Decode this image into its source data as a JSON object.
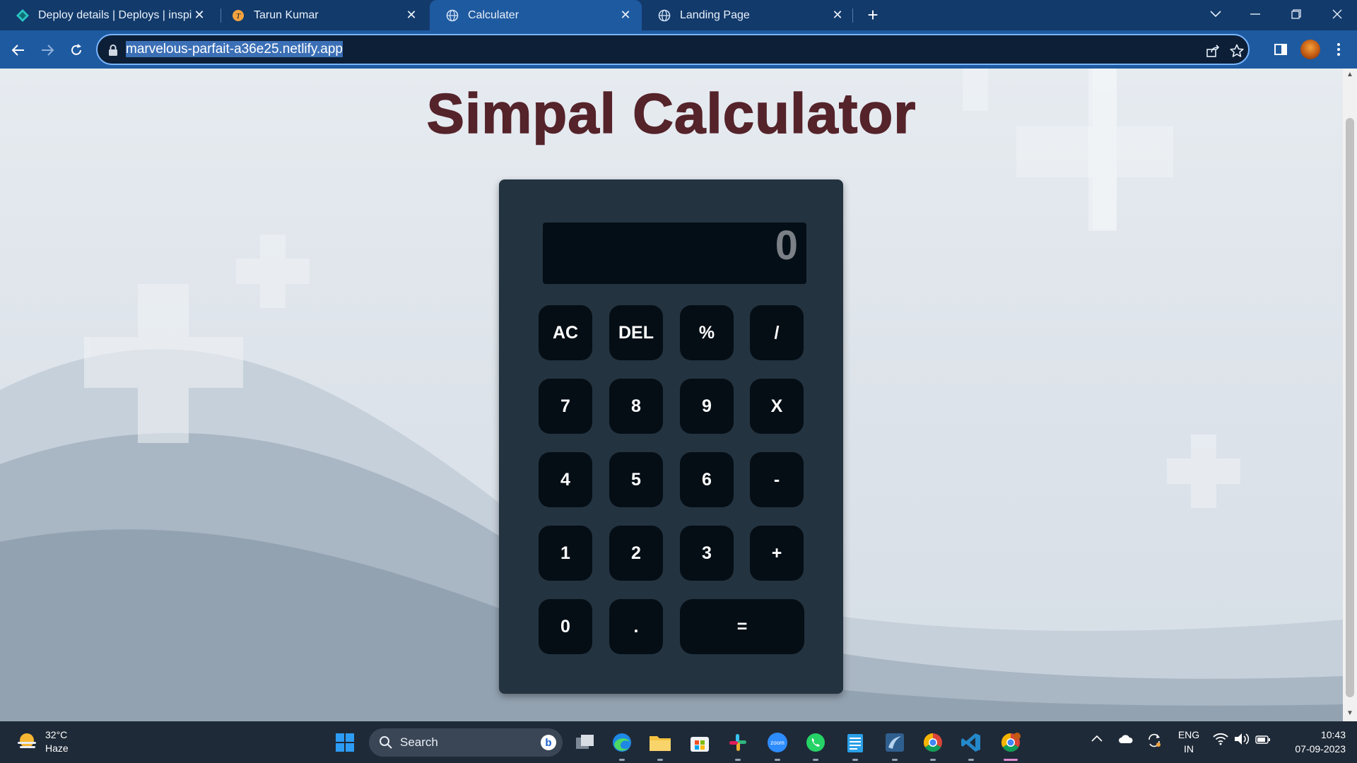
{
  "browser": {
    "tabs": [
      {
        "title": "Deploy details | Deploys | inspirin",
        "active": false
      },
      {
        "title": "Tarun Kumar",
        "active": false
      },
      {
        "title": "Calculater",
        "active": true
      },
      {
        "title": "Landing Page",
        "active": false
      }
    ],
    "url": "marvelous-parfait-a36e25.netlify.app"
  },
  "page": {
    "heading": "Simpal Calculator",
    "display": "0",
    "keys": [
      "AC",
      "DEL",
      "%",
      "/",
      "7",
      "8",
      "9",
      "X",
      "4",
      "5",
      "6",
      "-",
      "1",
      "2",
      "3",
      "+",
      "0",
      ".",
      "="
    ]
  },
  "taskbar": {
    "weather": {
      "temp": "32°C",
      "condition": "Haze"
    },
    "search_label": "Search",
    "language": {
      "line1": "ENG",
      "line2": "IN"
    },
    "time": "10:43",
    "date": "07-09-2023"
  },
  "colors": {
    "heading": "#55232a",
    "calculator_body": "#243340",
    "key": "#050e15",
    "display": "#040e16",
    "tab_strip": "#123a6b",
    "toolbar": "#1e5aa0"
  }
}
